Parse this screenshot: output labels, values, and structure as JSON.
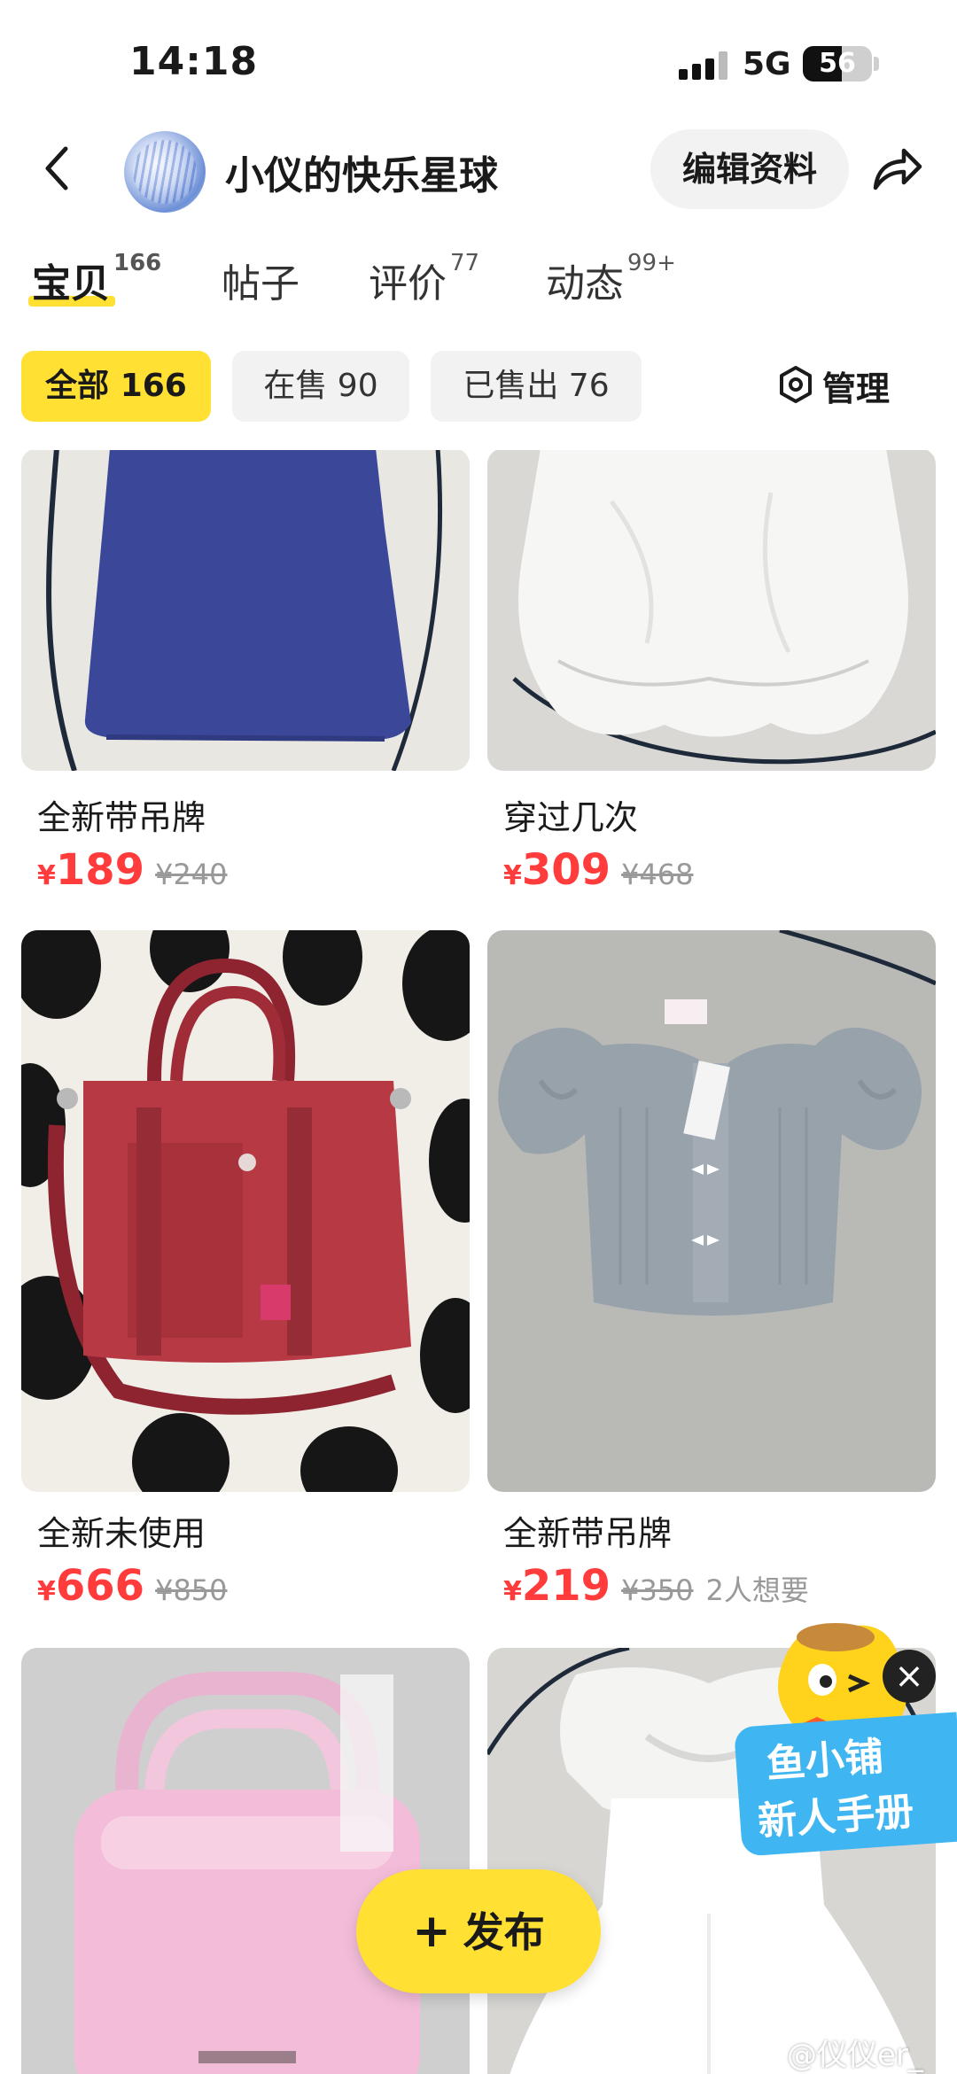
{
  "status_bar": {
    "time": "14:18",
    "network": "5G",
    "battery": "56",
    "battery_level": 0.56
  },
  "header": {
    "shop_name": "小仪的快乐星球",
    "edit_label": "编辑资料"
  },
  "tabs": [
    {
      "label": "宝贝",
      "count": "166"
    },
    {
      "label": "帖子",
      "count": ""
    },
    {
      "label": "评价",
      "count": "77"
    },
    {
      "label": "动态",
      "count": "99+"
    }
  ],
  "filters": [
    {
      "label": "全部 166"
    },
    {
      "label": "在售 90"
    },
    {
      "label": "已售出 76"
    }
  ],
  "manage_label": "管理",
  "products": [
    {
      "title": "全新带吊牌",
      "currency": "¥",
      "price": "189",
      "original_price": "¥240",
      "wants": ""
    },
    {
      "title": "穿过几次",
      "currency": "¥",
      "price": "309",
      "original_price": "¥468",
      "wants": ""
    },
    {
      "title": "全新未使用",
      "currency": "¥",
      "price": "666",
      "original_price": "¥850",
      "wants": ""
    },
    {
      "title": "全新带吊牌",
      "currency": "¥",
      "price": "219",
      "original_price": "¥350",
      "wants": "2人想要"
    }
  ],
  "publish_label": "发布",
  "promo": {
    "line1": "鱼小铺",
    "line2": "新人手册"
  },
  "watermark": "@仪仪er_",
  "colors": {
    "accent_yellow": "#ffe033",
    "price_red": "#ff3b3b",
    "promo_blue": "#3fb6f2"
  }
}
